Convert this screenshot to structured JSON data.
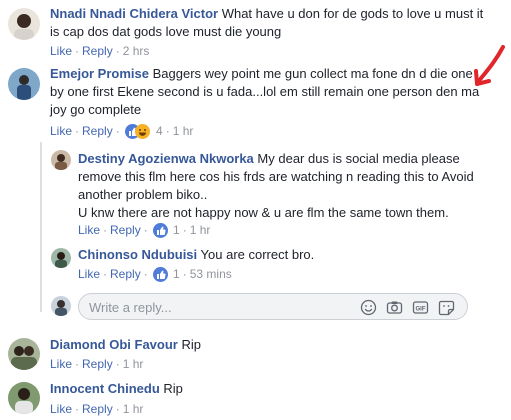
{
  "comments": [
    {
      "author": "Nnadi Nnadi Chidera Victor",
      "text": "What have u don for de gods to love u must it is cap dos dat gods love must die young",
      "like": "Like",
      "reply": "Reply",
      "time": "2 hrs"
    },
    {
      "author": "Emejor Promise",
      "text": "Baggers wey point me gun collect ma fone dn d die one by one first Ekene second is u fada...lol em still remain one person den ma joy go complete",
      "like": "Like",
      "reply": "Reply",
      "reaction_count": "4",
      "time": "1 hr"
    }
  ],
  "replies": [
    {
      "author": "Destiny Agozienwa Nkworka",
      "text": "My dear dus is social media please remove this flm here cos his frds are watching n reading this to Avoid another problem biko..",
      "text2": "U knw there are not happy now & u are flm the same town them.",
      "like": "Like",
      "reply": "Reply",
      "reaction_count": "1",
      "time": "1 hr"
    },
    {
      "author": "Chinonso Ndubuisi",
      "text": "You are correct bro.",
      "like": "Like",
      "reply": "Reply",
      "reaction_count": "1",
      "time": "53 mins"
    }
  ],
  "reply_box": {
    "placeholder": "Write a reply..."
  },
  "more_comments": [
    {
      "author": "Diamond Obi Favour",
      "text": "Rip",
      "like": "Like",
      "reply": "Reply",
      "time": "1 hr"
    },
    {
      "author": "Innocent Chinedu",
      "text": "Rip",
      "like": "Like",
      "reply": "Reply",
      "time": "1 hr"
    }
  ],
  "colors": {
    "author": "#365899",
    "action": "#4267b2",
    "muted": "#90949c",
    "arrow": "#e0262b"
  }
}
